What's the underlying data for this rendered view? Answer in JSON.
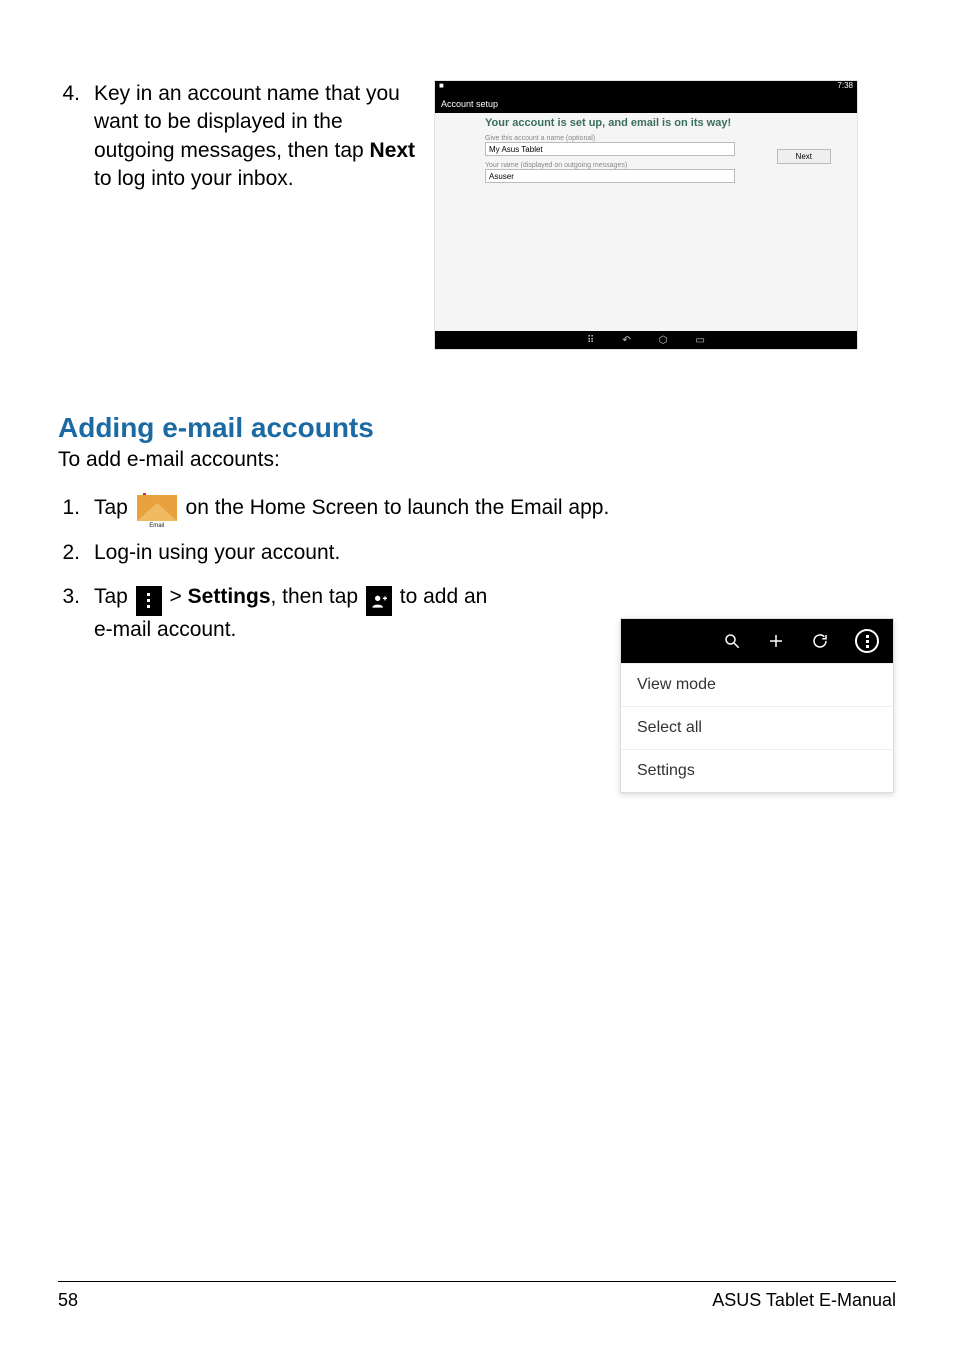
{
  "step4": {
    "number": "4.",
    "text_a": "Key in an account name that you want to be displayed in the outgoing messages, then tap ",
    "bold": "Next",
    "text_b": " to log into your inbox."
  },
  "shot1": {
    "time": "7:38",
    "breadcrumb": "Account setup",
    "title": "Your account is set up, and email is on its way!",
    "label1": "Give this account a name (optional)",
    "field1": "My Asus Tablet",
    "label2": "Your name (displayed on outgoing messages)",
    "field2": "Asuser",
    "next_btn": "Next"
  },
  "heading": "Adding e-mail accounts",
  "lead": "To add e-mail accounts:",
  "step1": {
    "number": "1.",
    "text_a": "Tap ",
    "email_caption": "Email",
    "text_b": " on the Home Screen to launch the Email app."
  },
  "step2": {
    "number": "2.",
    "text": "Log-in using your account."
  },
  "step3": {
    "number": "3.",
    "text_a": "Tap ",
    "text_b": " > ",
    "bold": "Settings",
    "text_c": ", then tap ",
    "text_d": " to add an ",
    "text_e": "e-mail account."
  },
  "menu": {
    "items": [
      "View mode",
      "Select all",
      "Settings"
    ]
  },
  "footer": {
    "page": "58",
    "title": "ASUS Tablet E-Manual"
  }
}
